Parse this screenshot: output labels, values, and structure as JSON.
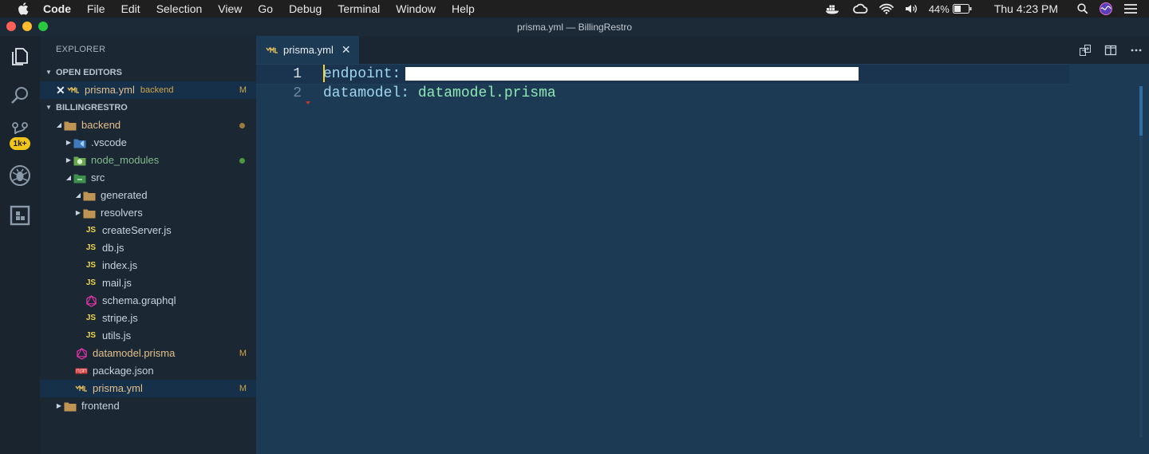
{
  "menubar": {
    "app_name": "Code",
    "items": [
      "File",
      "Edit",
      "Selection",
      "View",
      "Go",
      "Debug",
      "Terminal",
      "Window",
      "Help"
    ],
    "battery": "44%",
    "clock": "Thu 4:23 PM"
  },
  "window": {
    "title": "prisma.yml — BillingRestro"
  },
  "activity_bar": {
    "scm_badge": "1k+"
  },
  "sidebar": {
    "title": "EXPLORER",
    "open_editors": {
      "header": "OPEN EDITORS",
      "items": [
        {
          "name": "prisma.yml",
          "description": "backend",
          "status": "M"
        }
      ]
    },
    "workspace": {
      "header": "BILLINGRESTRO",
      "tree": [
        {
          "name": "backend"
        },
        {
          "name": ".vscode"
        },
        {
          "name": "node_modules"
        },
        {
          "name": "src"
        },
        {
          "name": "generated"
        },
        {
          "name": "resolvers"
        },
        {
          "name": "createServer.js",
          "icon_text": "JS"
        },
        {
          "name": "db.js",
          "icon_text": "JS"
        },
        {
          "name": "index.js",
          "icon_text": "JS"
        },
        {
          "name": "mail.js",
          "icon_text": "JS"
        },
        {
          "name": "schema.graphql"
        },
        {
          "name": "stripe.js",
          "icon_text": "JS"
        },
        {
          "name": "utils.js",
          "icon_text": "JS"
        },
        {
          "name": "datamodel.prisma",
          "status": "M"
        },
        {
          "name": "package.json"
        },
        {
          "name": "prisma.yml",
          "status": "M"
        },
        {
          "name": "frontend"
        }
      ]
    }
  },
  "editor": {
    "tab": {
      "label": "prisma.yml"
    },
    "lines": [
      {
        "number": "1",
        "key": "endpoint:",
        "value": ""
      },
      {
        "number": "2",
        "key": "datamodel:",
        "value": "datamodel.prisma"
      }
    ]
  },
  "colors": {
    "git_modified": "#e2c08d",
    "git_untracked": "#81b88b",
    "badge": "#f0c419",
    "cursor": "#f2d53d"
  }
}
